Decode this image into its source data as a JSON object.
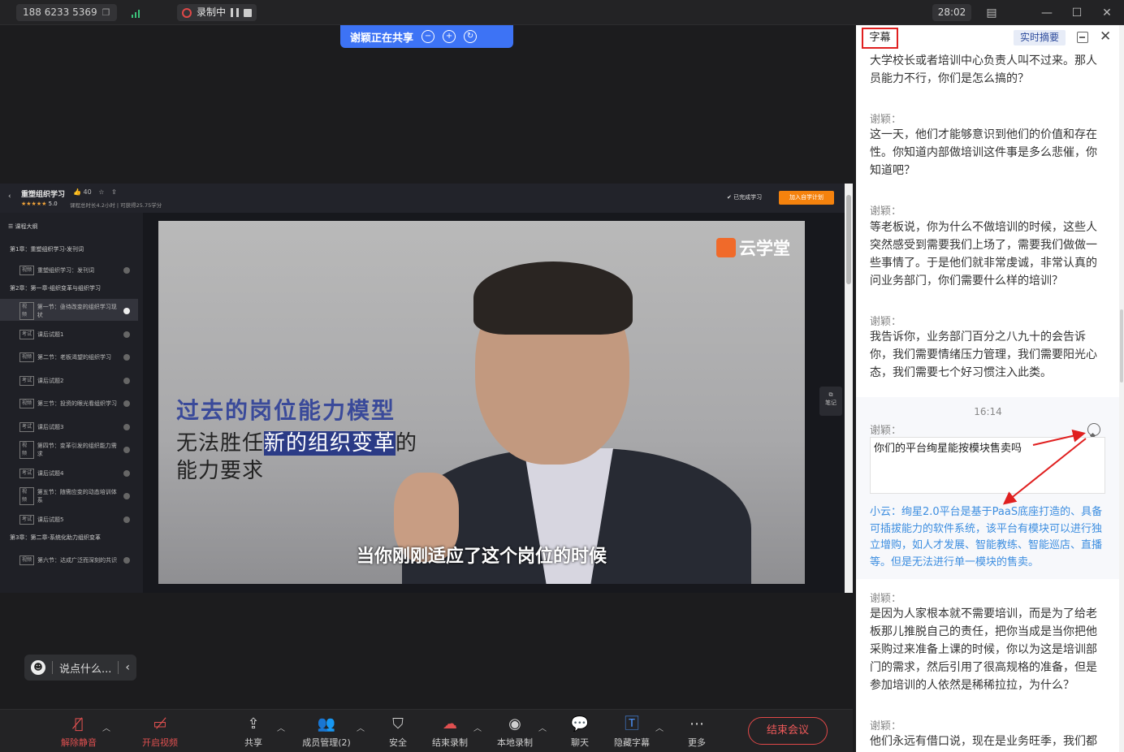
{
  "topbar": {
    "phone": "188 6233 5369",
    "recording_label": "录制中",
    "clock": "28:02"
  },
  "share_banner": {
    "label": "谢颖正在共享"
  },
  "shared_screen": {
    "course_title": "重塑组织学习",
    "likes": "40",
    "rating": "5.0",
    "meta": "课程总时长4.2小时 | 可获得25.75学分",
    "completed": "已完成学习",
    "join_plan": "加入自学计划",
    "outline_header": "课程大纲",
    "outline": [
      {
        "type": "chap",
        "text": "第1章：重塑组织学习-发刊词"
      },
      {
        "type": "item",
        "tag": "视频",
        "text": "重塑组织学习：发刊词"
      },
      {
        "type": "chap",
        "text": "第2章：第一章-组织变革与组织学习"
      },
      {
        "type": "item",
        "tag": "视频",
        "text": "第一节：亟待改变的组织学习现状",
        "active": true
      },
      {
        "type": "item",
        "tag": "考试",
        "text": "课后试题1"
      },
      {
        "type": "item",
        "tag": "视频",
        "text": "第二节：老板渴望的组织学习"
      },
      {
        "type": "item",
        "tag": "考试",
        "text": "课后试题2"
      },
      {
        "type": "item",
        "tag": "视频",
        "text": "第三节：投资的眼光看组织学习"
      },
      {
        "type": "item",
        "tag": "考试",
        "text": "课后试题3"
      },
      {
        "type": "item",
        "tag": "视频",
        "text": "第四节：变革引发的组织能力需求"
      },
      {
        "type": "item",
        "tag": "考试",
        "text": "课后试题4"
      },
      {
        "type": "item",
        "tag": "视频",
        "text": "第五节：随需应变的动态培训体系"
      },
      {
        "type": "item",
        "tag": "考试",
        "text": "课后试题5"
      },
      {
        "type": "chap",
        "text": "第3章：第二章-系统化助力组织变革"
      },
      {
        "type": "item",
        "tag": "视频",
        "text": "第六节：达成广泛而深刻的共识"
      }
    ],
    "video_logo": "云学堂",
    "caption_title": "过去的岗位能力模型",
    "caption_l2_pre": "无法胜任",
    "caption_l2_hl": "新的组织变革",
    "caption_l2_post": "的",
    "caption_l3": "能力要求",
    "subtitle": "当你刚刚适应了这个岗位的时候",
    "notes_label": "笔记"
  },
  "chat_input": {
    "placeholder": "说点什么..."
  },
  "toolbar": {
    "unmute": "解除静音",
    "video": "开启视频",
    "share": "共享",
    "members": "成员管理(2)",
    "security": "安全",
    "end_record": "结束录制",
    "local_record": "本地录制",
    "chat": "聊天",
    "captions": "隐藏字幕",
    "more": "更多",
    "end_meeting": "结束会议"
  },
  "panel": {
    "tab_subtitles": "字幕",
    "tab_summary": "实时摘要",
    "blocks": [
      {
        "speaker": "",
        "text": "大学校长或者培训中心负责人叫不过来。那人员能力不行，你们是怎么搞的？"
      },
      {
        "speaker": "谢颖：",
        "text": "这一天，他们才能够意识到他们的价值和存在性。你知道内部做培训这件事是多么悲催，你知道吧？"
      },
      {
        "speaker": "谢颖：",
        "text": "等老板说，你为什么不做培训的时候，这些人突然感受到需要我们上场了，需要我们做做一些事情了。于是他们就非常虔诚，非常认真的问业务部门，你们需要什么样的培训？"
      },
      {
        "speaker": "谢颖：",
        "text": "我告诉你，业务部门百分之八九十的会告诉你，我们需要情绪压力管理，我们需要阳光心态，我们需要七个好习惯注入此类。"
      }
    ],
    "time": "16:14",
    "q_speaker": "谢颖：",
    "question": "你们的平台绚星能按模块售卖吗",
    "answer": "小云：绚星2.0平台是基于PaaS底座打造的、具备可插拔能力的软件系统，该平台有模块可以进行独立增购，如人才发展、智能教练、智能巡店、直播等。但是无法进行单一模块的售卖。",
    "after": [
      {
        "speaker": "谢颖：",
        "text": "是因为人家根本就不需要培训，而是为了给老板那儿推脱自己的责任，把你当成是当你把他采购过来准备上课的时候，你以为这是培训部门的需求，然后引用了很高规格的准备，但是参加培训的人依然是稀稀拉拉，为什么？"
      },
      {
        "speaker": "谢颖：",
        "text": "他们永远有借口说，现在是业务旺季，我们都"
      }
    ]
  }
}
